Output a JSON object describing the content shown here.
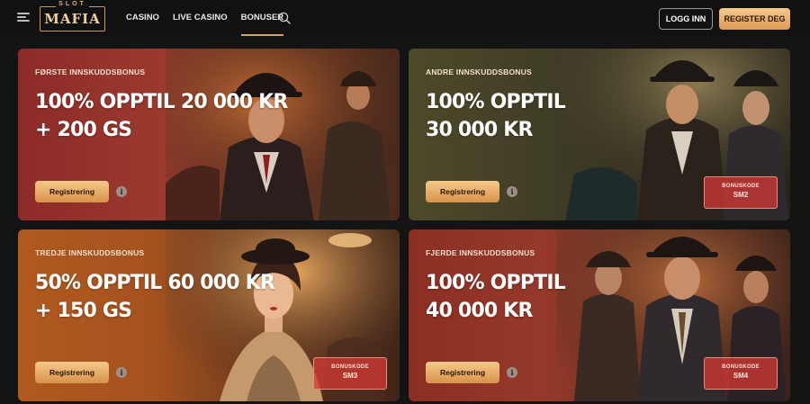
{
  "header": {
    "logo_top": "SLOT",
    "logo_main": "MAFIA",
    "nav": [
      {
        "label": "CASINO"
      },
      {
        "label": "LIVE CASINO"
      },
      {
        "label": "BONUSER"
      }
    ],
    "active_nav": "BONUSER",
    "login_label": "LOGG INN",
    "register_label": "REGISTER DEG"
  },
  "cards": [
    {
      "label": "FØRSTE INNSKUDDSBONUS",
      "headline_line1": "100% OPPTIL 20 000 KR",
      "headline_line2": "+ 200 GS",
      "button_label": "Registrering",
      "info": "i"
    },
    {
      "label": "ANDRE INNSKUDDSBONUS",
      "headline_line1": "100% OPPTIL",
      "headline_line2": "30 000 KR",
      "button_label": "Registrering",
      "info": "i",
      "code_label": "BONUSKODE",
      "code": "SM2"
    },
    {
      "label": "TREDJE INNSKUDDSBONUS",
      "headline_line1": "50% OPPTIL 60 000 KR",
      "headline_line2": "+ 150 GS",
      "button_label": "Registrering",
      "info": "i",
      "code_label": "BONUSKODE",
      "code": "SM3"
    },
    {
      "label": "FJERDE INNSKUDDSBONUS",
      "headline_line1": "100% OPPTIL",
      "headline_line2": "40 000 KR",
      "button_label": "Registrering",
      "info": "i",
      "code_label": "BONUSKODE",
      "code": "SM4"
    }
  ],
  "colors": {
    "accent": "#e0a462",
    "card1": "#8a2a26",
    "card2": "#4a4527",
    "card3": "#a8551c",
    "card4": "#8a2f22"
  }
}
